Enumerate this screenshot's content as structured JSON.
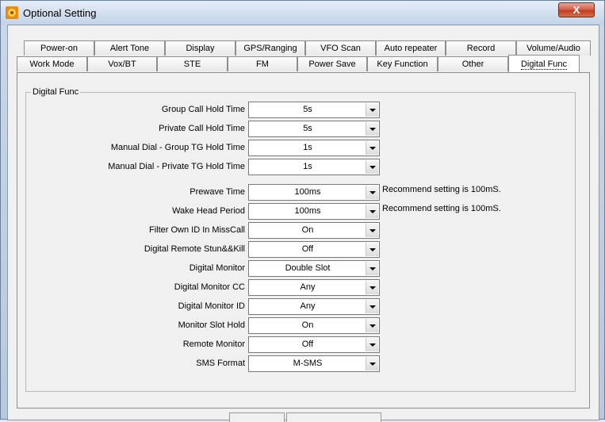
{
  "window": {
    "title": "Optional Setting",
    "close_label": "X"
  },
  "tabs_row_back": [
    "Power-on",
    "Alert Tone",
    "Display",
    "GPS/Ranging",
    "VFO Scan",
    "Auto repeater",
    "Record",
    "Volume/Audio"
  ],
  "tabs_row_front": [
    "Work Mode",
    "Vox/BT",
    "STE",
    "FM",
    "Power Save",
    "Key Function",
    "Other",
    "Digital Func"
  ],
  "selected_tab": "Digital Func",
  "group": {
    "title": "Digital Func"
  },
  "fields": [
    {
      "label": "Group Call Hold Time",
      "value": "5s",
      "hint": ""
    },
    {
      "label": "Private Call Hold Time",
      "value": "5s",
      "hint": ""
    },
    {
      "label": "Manual Dial - Group TG Hold Time",
      "value": "1s",
      "hint": ""
    },
    {
      "label": "Manual Dial - Private TG Hold Time",
      "value": "1s",
      "hint": ""
    },
    {
      "label": "Prewave Time",
      "value": "100ms",
      "hint": "Recommend setting is 100mS."
    },
    {
      "label": "Wake Head Period",
      "value": "100ms",
      "hint": "Recommend setting is 100mS."
    },
    {
      "label": "Filter Own ID In MissCall",
      "value": "On",
      "hint": ""
    },
    {
      "label": "Digital Remote Stun&&Kill",
      "value": "Off",
      "hint": ""
    },
    {
      "label": "Digital Monitor",
      "value": "Double Slot",
      "hint": ""
    },
    {
      "label": "Digital Monitor CC",
      "value": "Any",
      "hint": ""
    },
    {
      "label": "Digital Monitor ID",
      "value": "Any",
      "hint": ""
    },
    {
      "label": "Monitor Slot Hold",
      "value": "On",
      "hint": ""
    },
    {
      "label": "Remote Monitor",
      "value": "Off",
      "hint": ""
    },
    {
      "label": "SMS Format",
      "value": "M-SMS",
      "hint": ""
    }
  ]
}
